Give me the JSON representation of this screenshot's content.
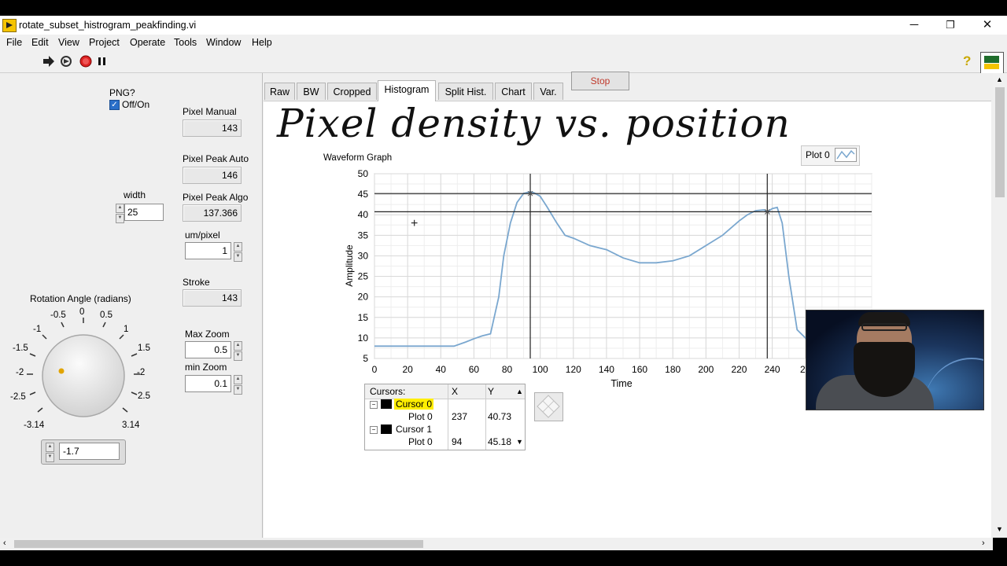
{
  "window": {
    "title": "rotate_subset_histrogram_peakfinding.vi",
    "minimize": "─",
    "restore": "❐",
    "close": "✕"
  },
  "menu": [
    "File",
    "Edit",
    "View",
    "Project",
    "Operate",
    "Tools",
    "Window",
    "Help"
  ],
  "toolbar": {
    "run_icon": "arrow-right-icon",
    "run_cont_icon": "run-continuously-icon",
    "abort_icon": "stop-sign-icon",
    "pause_icon": "pause-icon",
    "help_icon": "?"
  },
  "controls": {
    "png_label": "PNG?",
    "png_toggle_label": "Off/On",
    "width_label": "width",
    "width_value": "25",
    "rotation_label": "Rotation Angle (radians)",
    "rotation_value": "-1.7",
    "dial_ticks": [
      "-0.5",
      "0",
      "0.5",
      "-1",
      "1",
      "-1.5",
      "1.5",
      "-2",
      "-2",
      "-2.5",
      "2.5",
      "-3.14",
      "3.14"
    ],
    "pixel_manual_label": "Pixel Manual",
    "pixel_manual_value": "143",
    "pixel_peak_auto_label": "Pixel Peak Auto",
    "pixel_peak_auto_value": "146",
    "pixel_peak_algo_label": "Pixel Peak Algo",
    "pixel_peak_algo_value": "137.366",
    "um_pixel_label": "um/pixel",
    "um_pixel_value": "1",
    "stroke_label": "Stroke",
    "stroke_value": "143",
    "max_zoom_label": "Max Zoom",
    "max_zoom_value": "0.5",
    "min_zoom_label": "min Zoom",
    "min_zoom_value": "0.1"
  },
  "stop_button": "Stop",
  "tabs": [
    "Raw",
    "BW",
    "Cropped",
    "Histogram",
    "Split Hist.",
    "Chart",
    "Var."
  ],
  "active_tab": "Histogram",
  "annotation": "Pixel density vs. position",
  "graph": {
    "label": "Waveform Graph",
    "legend": "Plot 0",
    "colors": {
      "plot": "#7aa7cf",
      "grid": "#d9d9d9",
      "cursor": "#222222",
      "highlight": "#ffee00"
    }
  },
  "chart_data": {
    "type": "line",
    "xlabel": "Time",
    "ylabel": "Amplitude",
    "xlim": [
      0,
      300
    ],
    "ylim": [
      5,
      50
    ],
    "xticks": [
      0,
      20,
      40,
      60,
      80,
      100,
      120,
      140,
      160,
      180,
      200,
      220,
      240,
      260
    ],
    "xtick_labels": [
      "0",
      "20",
      "40",
      "60",
      "80",
      "100",
      "120",
      "140",
      "160",
      "180",
      "200",
      "220",
      "240",
      "26"
    ],
    "yticks": [
      5,
      10,
      15,
      20,
      25,
      30,
      35,
      40,
      45,
      50
    ],
    "grid": true,
    "series": [
      {
        "name": "Plot 0",
        "x": [
          0,
          10,
          20,
          30,
          40,
          48,
          55,
          60,
          65,
          70,
          75,
          78,
          82,
          86,
          90,
          94,
          96,
          100,
          104,
          110,
          115,
          120,
          130,
          140,
          150,
          160,
          170,
          180,
          190,
          200,
          210,
          220,
          225,
          230,
          235,
          237,
          240,
          243,
          246,
          250,
          255,
          260,
          262,
          268
        ],
        "y": [
          8,
          8,
          8,
          8,
          8,
          8,
          9,
          9.8,
          10.5,
          11,
          20,
          30,
          38,
          43,
          45.2,
          45.6,
          45.4,
          44.5,
          42,
          38,
          35,
          34.3,
          32.5,
          31.5,
          29.5,
          28.3,
          28.3,
          28.8,
          30,
          32.5,
          35,
          38.5,
          40,
          41,
          41.2,
          40.7,
          41.5,
          41.8,
          38,
          25,
          12,
          10,
          9,
          8
        ]
      }
    ],
    "cursors": [
      {
        "name": "Cursor 0",
        "plot": "Plot 0",
        "x": "237",
        "y": "40.73"
      },
      {
        "name": "Cursor 1",
        "plot": "Plot 0",
        "x": "94",
        "y": "45.18"
      }
    ],
    "cursor_headers": {
      "title": "Cursors:",
      "x": "X",
      "y": "Y"
    }
  }
}
